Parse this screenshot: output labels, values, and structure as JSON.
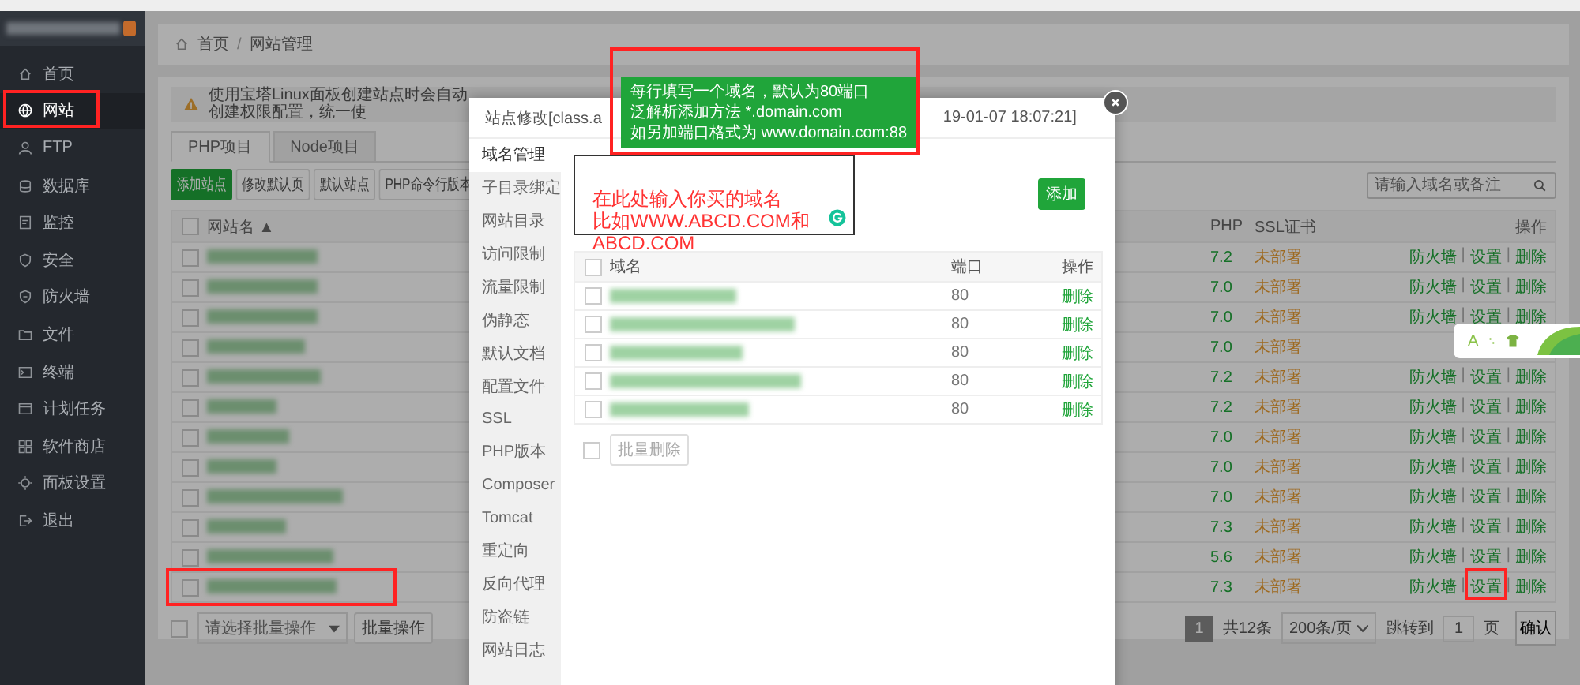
{
  "sidebar": {
    "items": [
      {
        "label": "首页",
        "selected": false
      },
      {
        "label": "网站",
        "selected": true
      },
      {
        "label": "FTP",
        "selected": false
      },
      {
        "label": "数据库",
        "selected": false
      },
      {
        "label": "监控",
        "selected": false
      },
      {
        "label": "安全",
        "selected": false
      },
      {
        "label": "防火墙",
        "selected": false
      },
      {
        "label": "文件",
        "selected": false
      },
      {
        "label": "终端",
        "selected": false
      },
      {
        "label": "计划任务",
        "selected": false
      },
      {
        "label": "软件商店",
        "selected": false
      },
      {
        "label": "面板设置",
        "selected": false
      },
      {
        "label": "退出",
        "selected": false
      }
    ]
  },
  "breadcrumb": {
    "items": [
      "首页",
      "网站管理"
    ],
    "separator": "/"
  },
  "notice": "使用宝塔Linux面板创建站点时会自动创建权限配置，统一使",
  "project_tabs": [
    {
      "label": "PHP项目",
      "selected": true
    },
    {
      "label": "Node项目",
      "selected": false
    }
  ],
  "toolbar_buttons": [
    {
      "label": "添加站点",
      "kind": "primary"
    },
    {
      "label": "修改默认页",
      "kind": "default"
    },
    {
      "label": "默认站点",
      "kind": "default"
    },
    {
      "label": "PHP命令行版本",
      "kind": "default"
    }
  ],
  "search": {
    "placeholder": "请输入域名或备注"
  },
  "site_table": {
    "all_checked": false,
    "columns": [
      "网站名 ▲",
      "PHP",
      "SSL证书",
      "操作"
    ],
    "rows": [
      {
        "checked": false,
        "php": "7.2",
        "ssl": "未部署",
        "actions": [
          "防火墙",
          "设置",
          "删除"
        ],
        "separators": [
          "|",
          "|"
        ]
      },
      {
        "checked": false,
        "php": "7.0",
        "ssl": "未部署",
        "actions": [
          "防火墙",
          "设置",
          "删除"
        ],
        "separators": [
          "|",
          "|"
        ]
      },
      {
        "checked": false,
        "php": "7.0",
        "ssl": "未部署",
        "actions": [
          "防火墙",
          "设置",
          "删除"
        ],
        "separators": [
          "|",
          "|"
        ]
      },
      {
        "checked": false,
        "php": "7.0",
        "ssl": "未部署"
      },
      {
        "checked": false,
        "php": "7.2",
        "ssl": "未部署",
        "actions": [
          "防火墙",
          "设置",
          "删除"
        ],
        "separators": [
          "|",
          "|"
        ]
      },
      {
        "checked": false,
        "php": "7.2",
        "ssl": "未部署",
        "actions": [
          "防火墙",
          "设置",
          "删除"
        ],
        "separators": [
          "|",
          "|"
        ]
      },
      {
        "checked": false,
        "php": "7.0",
        "ssl": "未部署",
        "actions": [
          "防火墙",
          "设置",
          "删除"
        ],
        "separators": [
          "|",
          "|"
        ]
      },
      {
        "checked": false,
        "php": "7.0",
        "ssl": "未部署",
        "actions": [
          "防火墙",
          "设置",
          "删除"
        ],
        "separators": [
          "|",
          "|"
        ]
      },
      {
        "checked": false,
        "php": "7.0",
        "ssl": "未部署",
        "actions": [
          "防火墙",
          "设置",
          "删除"
        ],
        "separators": [
          "|",
          "|"
        ]
      },
      {
        "checked": false,
        "php": "7.3",
        "ssl": "未部署",
        "actions": [
          "防火墙",
          "设置",
          "删除"
        ],
        "separators": [
          "|",
          "|"
        ]
      },
      {
        "checked": false,
        "php": "5.6",
        "ssl": "未部署",
        "actions": [
          "防火墙",
          "设置",
          "删除"
        ],
        "separators": [
          "|",
          "|"
        ]
      },
      {
        "checked": false,
        "php": "7.3",
        "ssl": "未部署",
        "actions": [
          "防火墙",
          "设置",
          "删除"
        ],
        "separators": [
          "|",
          "|"
        ]
      }
    ]
  },
  "bulk": {
    "checked": false,
    "select": "请选择批量操作",
    "button": "批量操作"
  },
  "pagination": {
    "current": "1",
    "total": "共12条",
    "page_size": "200条/页",
    "jump_label": "跳转到",
    "jump_value": "1",
    "unit": "页",
    "confirm": "确认"
  },
  "modal": {
    "title_start": "站点修改[class.a",
    "title_end": "19-01-07 18:07:21]",
    "menu": [
      {
        "label": "域名管理",
        "selected": true
      },
      {
        "label": "子目录绑定",
        "selected": false
      },
      {
        "label": "网站目录",
        "selected": false
      },
      {
        "label": "访问限制",
        "selected": false
      },
      {
        "label": "流量限制",
        "selected": false
      },
      {
        "label": "伪静态",
        "selected": false
      },
      {
        "label": "默认文档",
        "selected": false
      },
      {
        "label": "配置文件",
        "selected": false
      },
      {
        "label": "SSL",
        "selected": false
      },
      {
        "label": "PHP版本",
        "selected": false
      },
      {
        "label": "Composer",
        "selected": false
      },
      {
        "label": "Tomcat",
        "selected": false
      },
      {
        "label": "重定向",
        "selected": false
      },
      {
        "label": "反向代理",
        "selected": false
      },
      {
        "label": "防盗链",
        "selected": false
      },
      {
        "label": "网站日志",
        "selected": false
      }
    ],
    "tooltip": [
      "每行填写一个域名，默认为80端口",
      "泛解析添加方法 *.domain.com",
      "如另加端口格式为 www.domain.com:88"
    ],
    "add_button": "添加",
    "domain_table": {
      "all_checked": false,
      "columns": [
        "域名",
        "端口",
        "操作"
      ],
      "rows": [
        {
          "checked": false,
          "port": "80",
          "action": "删除"
        },
        {
          "checked": false,
          "port": "80",
          "action": "删除"
        },
        {
          "checked": false,
          "port": "80",
          "action": "删除"
        },
        {
          "checked": false,
          "port": "80",
          "action": "删除"
        },
        {
          "checked": false,
          "port": "80",
          "action": "删除"
        }
      ]
    },
    "bulk_checked": false,
    "bulk_delete": "批量删除"
  },
  "annotation": {
    "lines": [
      "在此处输入你买的域名",
      "比如WWW.ABCD.COM和",
      "ABCD.COM"
    ]
  },
  "widget": {
    "text": "A"
  }
}
